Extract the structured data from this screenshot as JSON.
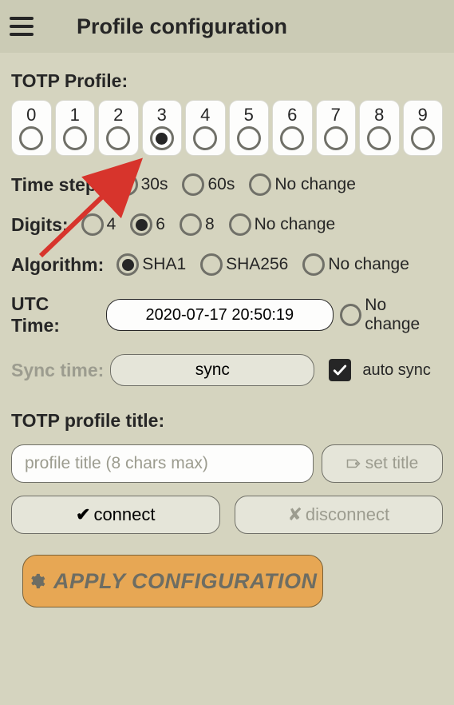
{
  "header": {
    "title": "Profile configuration"
  },
  "profile": {
    "label": "TOTP Profile:",
    "selectedIndex": 3,
    "items": [
      "0",
      "1",
      "2",
      "3",
      "4",
      "5",
      "6",
      "7",
      "8",
      "9"
    ]
  },
  "timestep": {
    "label": "Time step:",
    "selected": 0,
    "options": [
      "30s",
      "60s",
      "No change"
    ]
  },
  "digits": {
    "label": "Digits:",
    "selected": 1,
    "options": [
      "4",
      "6",
      "8",
      "No change"
    ]
  },
  "algorithm": {
    "label": "Algorithm:",
    "selected": 0,
    "options": [
      "SHA1",
      "SHA256",
      "No change"
    ]
  },
  "utc": {
    "label": "UTC Time:",
    "value": "2020-07-17 20:50:19",
    "nochange": "No change"
  },
  "sync": {
    "label": "Sync time:",
    "button": "sync",
    "auto_checked": true,
    "auto_label": "auto sync"
  },
  "profileTitle": {
    "label": "TOTP profile title:",
    "placeholder": "profile title (8 chars max)",
    "setTitle": "set title"
  },
  "footer": {
    "connect": "connect",
    "disconnect": "disconnect",
    "apply": "APPLY CONFIGURATION"
  }
}
